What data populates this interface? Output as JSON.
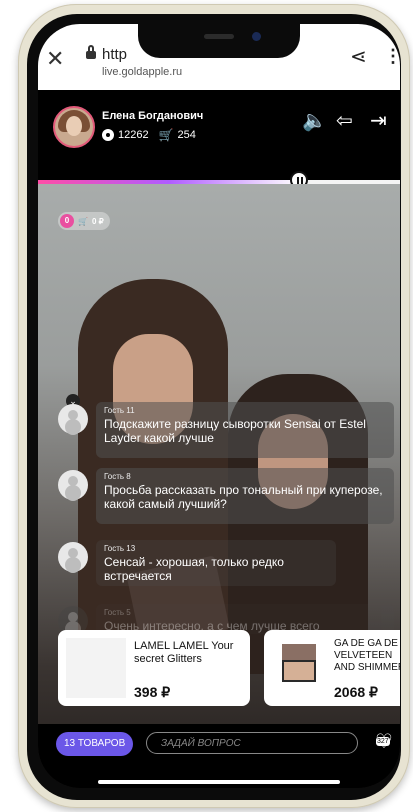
{
  "browser": {
    "url_main": "http",
    "url_domain": "live.goldapple.ru"
  },
  "stream": {
    "host_name": "Елена Богданович",
    "viewers": "12262",
    "cart_count": "254",
    "progress": 0.72
  },
  "overlay": {
    "badge_number": "0",
    "badge_price": "0 ₽"
  },
  "chat": [
    {
      "author": "Гость 11",
      "text": "Подскажите разницу сыворотки Sensai от Estel Layder какой лучше"
    },
    {
      "author": "Гость 8",
      "text": "Просьба рассказать про тональный при куперозе, какой самый лучший?"
    },
    {
      "author": "Гость 13",
      "text": "Сенсай - хорошая, только редко встречается"
    },
    {
      "author": "Гость 5",
      "text": "Очень интересно, а с чем лучше всего"
    }
  ],
  "products": [
    {
      "title": "LAMEL LAMEL Your secret Glitters",
      "price": "398 ₽"
    },
    {
      "title": "GA DE GA DE VELVETEEN AND SHIMMER",
      "price": "2068 ₽"
    }
  ],
  "bottom": {
    "goods_button": "13 ТОВАРОВ",
    "ask_placeholder": "ЗАДАЙ ВОПРОС",
    "likes": "327"
  },
  "colors": {
    "accent": "#6b57e8",
    "badge_pink": "#e94fa0",
    "progress_start": "#ff4da6"
  }
}
